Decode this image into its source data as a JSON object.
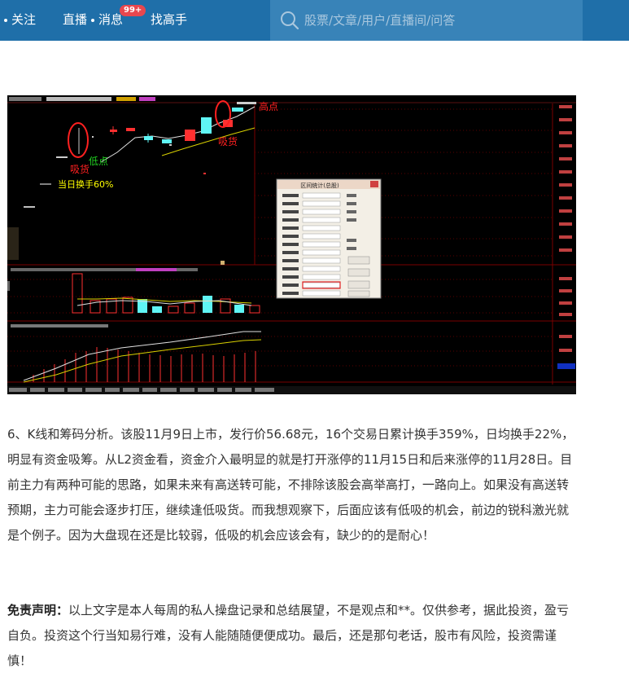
{
  "header": {
    "nav": [
      {
        "label": "关注"
      },
      {
        "label": "直播"
      },
      {
        "label": "消息",
        "badge": "99+"
      },
      {
        "label": "找高手"
      }
    ],
    "search": {
      "placeholder": "股票/文章/用户/直播间/问答"
    }
  },
  "screenshot": {
    "annotations": {
      "high_point": "高点",
      "absorb_right": "吸货",
      "low_point": "低点",
      "absorb_left": "吸货",
      "turnover": "当日换手60%"
    },
    "dialog_title": "区间统计(总股)",
    "colors": {
      "accent_red": "#ff2020",
      "candle_cyan": "#5ff5f5",
      "annot_green": "#20d020",
      "annot_yellow": "#ffff00"
    }
  },
  "article": {
    "paragraph1": "6、K线和筹码分析。该股11月9日上市，发行价56.68元，16个交易日累计换手359%，日均换手22%，明显有资金吸筹。从L2资金看，资金介入最明显的就是打开涨停的11月15日和后来涨停的11月28日。目前主力有两种可能的思路，如果未来有高送转可能，不排除该股会高举高打，一路向上。如果没有高送转预期，主力可能会逐步打压，继续逢低吸货。而我想观察下，后面应该有低吸的机会，前边的锐科激光就是个例子。因为大盘现在还是比较弱，低吸的机会应该会有，缺少的的是耐心！",
    "disclaimer_label": "免责声明：",
    "disclaimer_text": "以上文字是本人每周的私人操盘记录和总结展望，不是观点和**。仅供参考，据此投资，盈亏自负。投资这个行当知易行难，没有人能随随便便成功。最后，还是那句老话，股市有风险，投资需谨慎！"
  }
}
